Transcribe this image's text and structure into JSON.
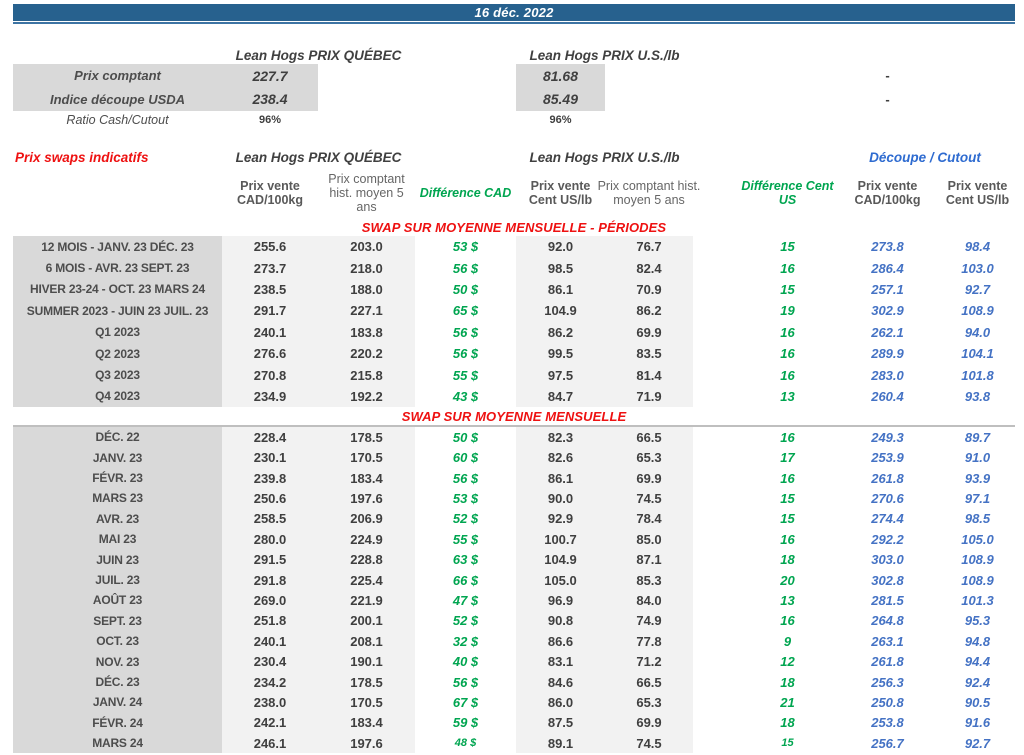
{
  "banner": {
    "date": "16 déc. 2022"
  },
  "colors": {
    "banner_blue": "#27618E",
    "label_gray": "#D9D9D9",
    "cell_gray": "#F2F2F2",
    "accent_red": "#EE1111",
    "accent_green": "#00A550",
    "accent_blue": "#4472C4",
    "cutout_header_blue": "#2E6BD0"
  },
  "spot": {
    "qc_header": "Lean Hogs PRIX QUÉBEC",
    "us_header": "Lean Hogs PRIX U.S./lb",
    "rows": [
      {
        "label": "Prix comptant",
        "qc": "227.7",
        "us": "81.68",
        "cutout": "-"
      },
      {
        "label": "Indice découpe USDA",
        "qc": "238.4",
        "us": "85.49",
        "cutout": "-"
      }
    ],
    "ratio": {
      "label": "Ratio Cash/Cutout",
      "qc": "96%",
      "us": "96%"
    }
  },
  "swaps": {
    "title": "Prix swaps indicatifs",
    "qc_header": "Lean Hogs PRIX QUÉBEC",
    "us_header": "Lean Hogs PRIX U.S./lb",
    "cutout_header": "Découpe / Cutout",
    "columns": [
      "Prix vente CAD/100kg",
      "Prix comptant hist. moyen 5 ans",
      "Différence CAD",
      "Prix vente Cent US/lb",
      "Prix comptant hist. moyen 5 ans",
      "Différence Cent US",
      "Prix vente CAD/100kg",
      "Prix vente Cent US/lb"
    ],
    "sections": [
      {
        "title": "SWAP SUR MOYENNE MENSUELLE - PÉRIODES",
        "rows": [
          [
            "12 MOIS - JANV. 23 DÉC. 23",
            "255.6",
            "203.0",
            "53 $",
            "92.0",
            "76.7",
            "15",
            "273.8",
            "98.4"
          ],
          [
            "6 MOIS - AVR. 23 SEPT. 23",
            "273.7",
            "218.0",
            "56 $",
            "98.5",
            "82.4",
            "16",
            "286.4",
            "103.0"
          ],
          [
            "HIVER 23-24 -  OCT. 23 MARS 24",
            "238.5",
            "188.0",
            "50 $",
            "86.1",
            "70.9",
            "15",
            "257.1",
            "92.7"
          ],
          [
            "SUMMER 2023 - JUIN 23 JUIL. 23",
            "291.7",
            "227.1",
            "65 $",
            "104.9",
            "86.2",
            "19",
            "302.9",
            "108.9"
          ],
          [
            "Q1 2023",
            "240.1",
            "183.8",
            "56 $",
            "86.2",
            "69.9",
            "16",
            "262.1",
            "94.0"
          ],
          [
            "Q2 2023",
            "276.6",
            "220.2",
            "56 $",
            "99.5",
            "83.5",
            "16",
            "289.9",
            "104.1"
          ],
          [
            "Q3 2023",
            "270.8",
            "215.8",
            "55 $",
            "97.5",
            "81.4",
            "16",
            "283.0",
            "101.8"
          ],
          [
            "Q4 2023",
            "234.9",
            "192.2",
            "43 $",
            "84.7",
            "71.9",
            "13",
            "260.4",
            "93.8"
          ]
        ]
      },
      {
        "title": "SWAP SUR MOYENNE MENSUELLE",
        "rows": [
          [
            "DÉC. 22",
            "228.4",
            "178.5",
            "50 $",
            "82.3",
            "66.5",
            "16",
            "249.3",
            "89.7"
          ],
          [
            "JANV. 23",
            "230.1",
            "170.5",
            "60 $",
            "82.6",
            "65.3",
            "17",
            "253.9",
            "91.0"
          ],
          [
            "FÉVR. 23",
            "239.8",
            "183.4",
            "56 $",
            "86.1",
            "69.9",
            "16",
            "261.8",
            "93.9"
          ],
          [
            "MARS 23",
            "250.6",
            "197.6",
            "53 $",
            "90.0",
            "74.5",
            "15",
            "270.6",
            "97.1"
          ],
          [
            "AVR. 23",
            "258.5",
            "206.9",
            "52 $",
            "92.9",
            "78.4",
            "15",
            "274.4",
            "98.5"
          ],
          [
            "MAI 23",
            "280.0",
            "224.9",
            "55 $",
            "100.7",
            "85.0",
            "16",
            "292.2",
            "105.0"
          ],
          [
            "JUIN 23",
            "291.5",
            "228.8",
            "63 $",
            "104.9",
            "87.1",
            "18",
            "303.0",
            "108.9"
          ],
          [
            "JUIL. 23",
            "291.8",
            "225.4",
            "66 $",
            "105.0",
            "85.3",
            "20",
            "302.8",
            "108.9"
          ],
          [
            "AOÛT 23",
            "269.0",
            "221.9",
            "47 $",
            "96.9",
            "84.0",
            "13",
            "281.5",
            "101.3"
          ],
          [
            "SEPT. 23",
            "251.8",
            "200.1",
            "52 $",
            "90.8",
            "74.9",
            "16",
            "264.8",
            "95.3"
          ],
          [
            "OCT. 23",
            "240.1",
            "208.1",
            "32 $",
            "86.6",
            "77.8",
            "9",
            "263.1",
            "94.8"
          ],
          [
            "NOV. 23",
            "230.4",
            "190.1",
            "40 $",
            "83.1",
            "71.2",
            "12",
            "261.8",
            "94.4"
          ],
          [
            "DÉC. 23",
            "234.2",
            "178.5",
            "56 $",
            "84.6",
            "66.5",
            "18",
            "256.3",
            "92.4"
          ],
          [
            "JANV. 24",
            "238.0",
            "170.5",
            "67 $",
            "86.0",
            "65.3",
            "21",
            "250.8",
            "90.5"
          ],
          [
            "FÉVR. 24",
            "242.1",
            "183.4",
            "59 $",
            "87.5",
            "69.9",
            "18",
            "253.8",
            "91.6"
          ],
          [
            "MARS 24",
            "246.1",
            "197.6",
            "48 $",
            "89.1",
            "74.5",
            "15",
            "256.7",
            "92.7"
          ]
        ]
      }
    ]
  }
}
